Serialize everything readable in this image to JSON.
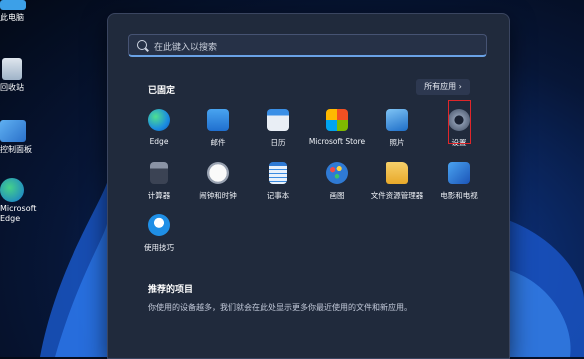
{
  "desktop": {
    "icons": [
      {
        "label": "此电脑",
        "icon": "computer-icon"
      },
      {
        "label": "回收站",
        "icon": "recycle-bin-icon"
      },
      {
        "label": "控制面板",
        "icon": "control-panel-icon"
      },
      {
        "label": "Microsoft Edge",
        "icon": "edge-icon"
      }
    ]
  },
  "start_menu": {
    "search_placeholder": "在此键入以搜索",
    "pinned_title": "已固定",
    "all_apps_label": "所有应用 ›",
    "pinned_apps": [
      {
        "label": "Edge",
        "icon": "edge-icon",
        "color": "#1b8de0"
      },
      {
        "label": "邮件",
        "icon": "mail-icon",
        "color": "#2a7fd6"
      },
      {
        "label": "日历",
        "icon": "calendar-icon",
        "color": "#2a7fd6"
      },
      {
        "label": "Microsoft Store",
        "icon": "store-icon",
        "color": "#f2f2f2"
      },
      {
        "label": "照片",
        "icon": "photos-icon",
        "color": "#4aa6e8"
      },
      {
        "label": "设置",
        "icon": "gear-icon",
        "color": "#6d7a8f"
      },
      {
        "label": "计算器",
        "icon": "calculator-icon",
        "color": "#5b6476"
      },
      {
        "label": "闹钟和时钟",
        "icon": "clock-icon",
        "color": "#d9d9d9"
      },
      {
        "label": "记事本",
        "icon": "notepad-icon",
        "color": "#3b8be0"
      },
      {
        "label": "画图",
        "icon": "paint-icon",
        "color": "#3a86d6"
      },
      {
        "label": "文件资源管理器",
        "icon": "folder-icon",
        "color": "#f4c542"
      },
      {
        "label": "电影和电视",
        "icon": "movies-icon",
        "color": "#2a6fd0"
      },
      {
        "label": "使用技巧",
        "icon": "tips-icon",
        "color": "#1f8fe6"
      }
    ],
    "recommended_title": "推荐的项目",
    "recommended_text": "你使用的设备越多，我们就会在此处显示更多你最近使用的文件和新应用。"
  },
  "colors": {
    "highlight_border": "#e0262a",
    "search_accent": "#6aa2e6"
  }
}
